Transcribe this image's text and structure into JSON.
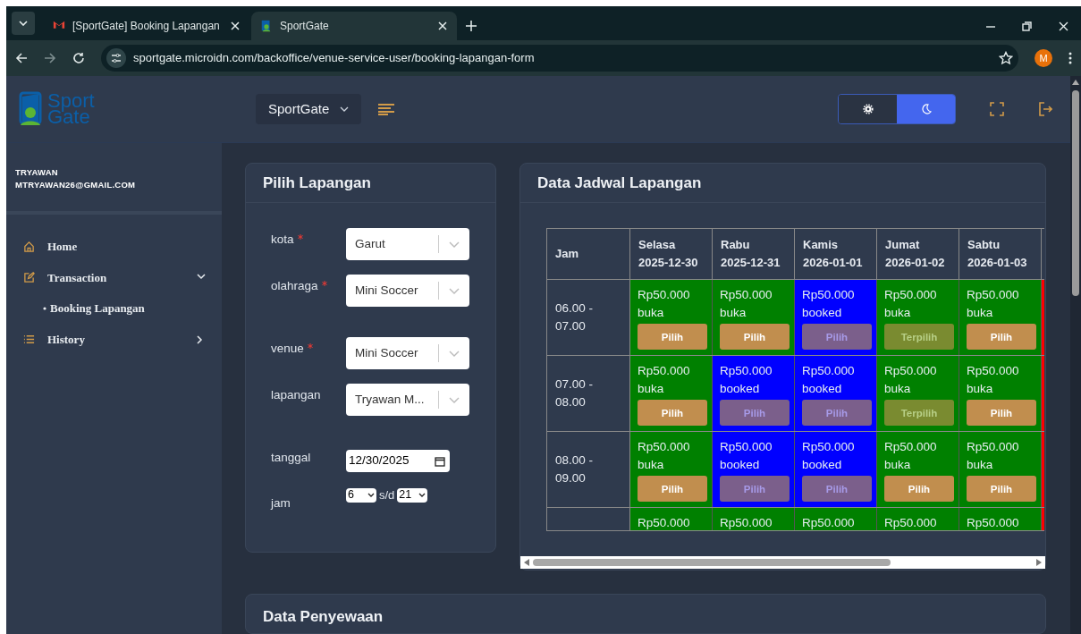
{
  "browser": {
    "tabs": [
      {
        "title": "[SportGate] Booking Lapangan",
        "kind": "mail",
        "selected": false
      },
      {
        "title": "SportGate",
        "kind": "site",
        "selected": true
      }
    ],
    "url": "sportgate.microidn.com/backoffice/venue-service-user/booking-lapangan-form",
    "profile_initial": "M"
  },
  "header": {
    "brand": [
      "Sport",
      "Gate"
    ],
    "project": "SportGate",
    "theme": [
      {
        "kind": "light",
        "selected": false
      },
      {
        "kind": "dark",
        "selected": true
      }
    ]
  },
  "user": {
    "name": "TRYAWAN",
    "email": "MTRYAWAN26@GMAIL.COM"
  },
  "nav": [
    {
      "label": "Home",
      "kind": "home"
    },
    {
      "label": "Transaction",
      "kind": "edit",
      "expanded": true,
      "children": [
        {
          "label": "Booking Lapangan"
        }
      ]
    },
    {
      "label": "History",
      "kind": "list",
      "expanded": false
    }
  ],
  "form": {
    "title": "Pilih Lapangan",
    "fields": [
      {
        "label": "kota",
        "required": true,
        "kind": "select",
        "value": "Garut"
      },
      {
        "label": "olahraga",
        "required": true,
        "kind": "select",
        "value": "Mini Soccer"
      },
      {
        "label": "venue",
        "required": true,
        "kind": "select",
        "value": "Mini Soccer"
      },
      {
        "label": "lapangan",
        "required": false,
        "kind": "select",
        "value": "Tryawan M..."
      },
      {
        "label": "tanggal",
        "required": false,
        "kind": "date",
        "value": "12/30/2025"
      },
      {
        "label": "jam",
        "required": false,
        "kind": "range",
        "from": "6",
        "separator": "s/d",
        "to": "21"
      }
    ]
  },
  "schedule": {
    "title": "Data Jadwal Lapangan",
    "columns": [
      {
        "day": "Jam"
      },
      {
        "day": "Selasa",
        "date": "2025-12-30"
      },
      {
        "day": "Rabu",
        "date": "2025-12-31"
      },
      {
        "day": "Kamis",
        "date": "2026-01-01"
      },
      {
        "day": "Jumat",
        "date": "2026-01-02"
      },
      {
        "day": "Sabtu",
        "date": "2026-01-03"
      }
    ],
    "rows": [
      {
        "cells": [
          {
            "kind": "time",
            "text": "06.00 - 07.00"
          },
          {
            "price": "Rp50.000",
            "status": "buka",
            "kind": "open",
            "button": {
              "label": "Pilih",
              "disabled": false,
              "selected": false
            }
          },
          {
            "price": "Rp50.000",
            "status": "buka",
            "kind": "open",
            "button": {
              "label": "Pilih",
              "disabled": false,
              "selected": false
            }
          },
          {
            "price": "Rp50.000",
            "status": "booked",
            "kind": "booked",
            "button": {
              "label": "Pilih",
              "disabled": true,
              "selected": false
            }
          },
          {
            "price": "Rp50.000",
            "status": "buka",
            "kind": "open",
            "button": {
              "label": "Terpilih",
              "disabled": false,
              "selected": true
            }
          },
          {
            "price": "Rp50.000",
            "status": "buka",
            "kind": "open",
            "button": {
              "label": "Pilih",
              "disabled": false,
              "selected": false
            }
          }
        ]
      },
      {
        "cells": [
          {
            "kind": "time",
            "text": "07.00 - 08.00"
          },
          {
            "price": "Rp50.000",
            "status": "buka",
            "kind": "open",
            "button": {
              "label": "Pilih",
              "disabled": false,
              "selected": false
            }
          },
          {
            "price": "Rp50.000",
            "status": "booked",
            "kind": "booked",
            "button": {
              "label": "Pilih",
              "disabled": true,
              "selected": false
            }
          },
          {
            "price": "Rp50.000",
            "status": "booked",
            "kind": "booked",
            "button": {
              "label": "Pilih",
              "disabled": true,
              "selected": false
            }
          },
          {
            "price": "Rp50.000",
            "status": "buka",
            "kind": "open",
            "button": {
              "label": "Terpilih",
              "disabled": false,
              "selected": true
            }
          },
          {
            "price": "Rp50.000",
            "status": "buka",
            "kind": "open",
            "button": {
              "label": "Pilih",
              "disabled": false,
              "selected": false
            }
          }
        ]
      },
      {
        "cells": [
          {
            "kind": "time",
            "text": "08.00 - 09.00"
          },
          {
            "price": "Rp50.000",
            "status": "buka",
            "kind": "open",
            "button": {
              "label": "Pilih",
              "disabled": false,
              "selected": false
            }
          },
          {
            "price": "Rp50.000",
            "status": "booked",
            "kind": "booked",
            "button": {
              "label": "Pilih",
              "disabled": true,
              "selected": false
            }
          },
          {
            "price": "Rp50.000",
            "status": "booked",
            "kind": "booked",
            "button": {
              "label": "Pilih",
              "disabled": true,
              "selected": false
            }
          },
          {
            "price": "Rp50.000",
            "status": "buka",
            "kind": "open",
            "button": {
              "label": "Pilih",
              "disabled": false,
              "selected": false
            }
          },
          {
            "price": "Rp50.000",
            "status": "buka",
            "kind": "open",
            "button": {
              "label": "Pilih",
              "disabled": false,
              "selected": false
            }
          }
        ]
      },
      {
        "cells": [
          {
            "kind": "time",
            "text": ""
          },
          {
            "price": "Rp50.000",
            "kind": "open"
          },
          {
            "price": "Rp50.000",
            "kind": "open"
          },
          {
            "price": "Rp50.000",
            "kind": "open"
          },
          {
            "price": "Rp50.000",
            "kind": "open"
          },
          {
            "price": "Rp50.000",
            "kind": "open"
          }
        ]
      }
    ]
  },
  "rental": {
    "title": "Data Penyewaan"
  }
}
